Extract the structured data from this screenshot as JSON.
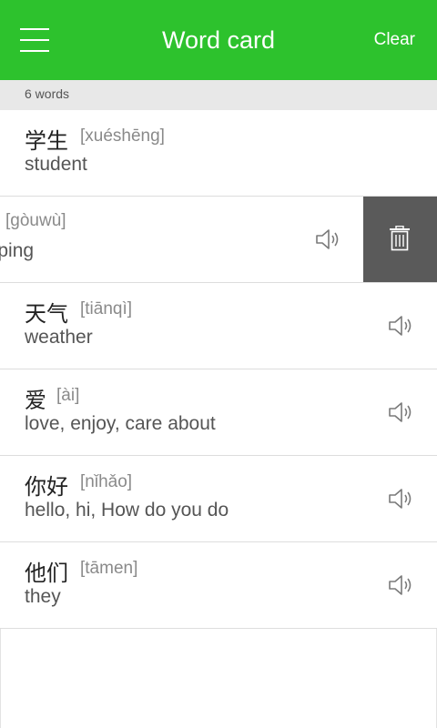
{
  "header": {
    "title": "Word card",
    "clear_label": "Clear",
    "bg_color": "#2dc22d"
  },
  "summary": {
    "count_text": "6 words"
  },
  "words": [
    {
      "hanzi": "学生",
      "pinyin": "[xuéshēng]",
      "meaning": "student"
    },
    {
      "hanzi": "",
      "pinyin": "[gòuwù]",
      "meaning": "opping"
    },
    {
      "hanzi": "天气",
      "pinyin": "[tiānqì]",
      "meaning": "weather"
    },
    {
      "hanzi": "爱",
      "pinyin": "[ài]",
      "meaning": "love, enjoy, care about"
    },
    {
      "hanzi": "你好",
      "pinyin": "[nǐhǎo]",
      "meaning": "hello, hi, How do you do"
    },
    {
      "hanzi": "他们",
      "pinyin": "[tāmen]",
      "meaning": "they"
    }
  ],
  "icons": {
    "menu": "menu-icon",
    "speaker": "speaker-icon",
    "delete": "trash-icon"
  }
}
